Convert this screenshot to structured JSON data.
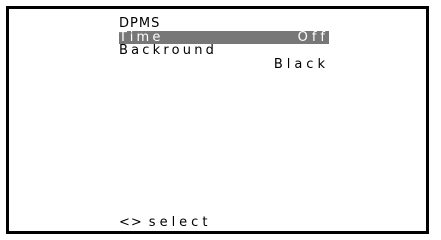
{
  "menu": {
    "title": "DPMS",
    "items": [
      {
        "label": "Time",
        "value": "Off",
        "selected": true
      },
      {
        "label": "Backround",
        "value": "Black",
        "selected": false
      }
    ]
  },
  "footer": {
    "arrows": "<>",
    "action": "select"
  },
  "colors": {
    "highlight": "#777777",
    "frame": "#000000",
    "background": "#ffffff"
  }
}
